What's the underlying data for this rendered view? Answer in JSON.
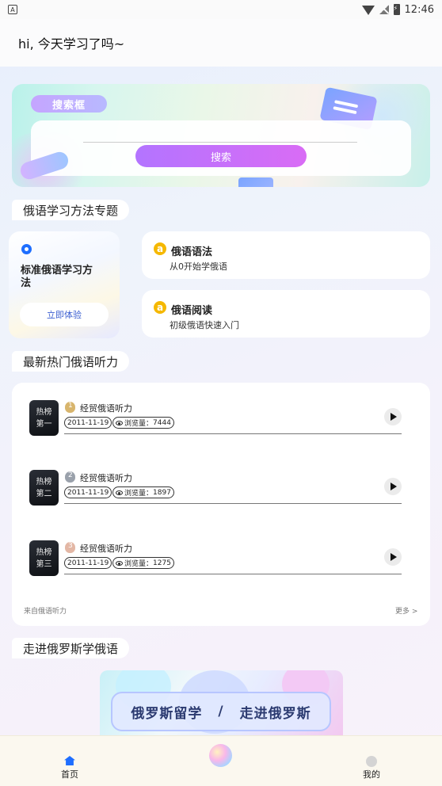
{
  "status_bar": {
    "app_icon_letter": "A",
    "time": "12:46"
  },
  "header": {
    "greeting": "hi, 今天学习了吗~"
  },
  "search": {
    "tag_label": "搜索框",
    "input_value": "",
    "input_placeholder": "",
    "button_label": "搜索"
  },
  "methods": {
    "section_title": "俄语学习方法专题",
    "feature": {
      "title": "标准俄语学习方法",
      "button_label": "立即体验"
    },
    "items": [
      {
        "title": "俄语语法",
        "subtitle": "从0开始学俄语"
      },
      {
        "title": "俄语阅读",
        "subtitle": "初级俄语快速入门"
      }
    ]
  },
  "hot": {
    "section_title": "最新热门俄语听力",
    "rows": [
      {
        "thumb_line1": "热榜",
        "thumb_line2": "第一",
        "rank": "1",
        "title": "经贸俄语听力",
        "date": "2011-11-19",
        "views_label": "浏览量：",
        "views": "7444"
      },
      {
        "thumb_line1": "热榜",
        "thumb_line2": "第二",
        "rank": "2",
        "title": "经贸俄语听力",
        "date": "2011-11-19",
        "views_label": "浏览量：",
        "views": "1897"
      },
      {
        "thumb_line1": "热榜",
        "thumb_line2": "第三",
        "rank": "3",
        "title": "经贸俄语听力",
        "date": "2011-11-19",
        "views_label": "浏览量：",
        "views": "1275"
      }
    ],
    "source": "来自俄语听力",
    "more": "更多 >"
  },
  "russia": {
    "section_title": "走进俄罗斯学俄语",
    "banner_left": "俄罗斯留学",
    "banner_sep": "/",
    "banner_right": "走进俄罗斯"
  },
  "bottom_nav": {
    "home_label": "首页",
    "mine_label": "我的"
  },
  "colors": {
    "accent_blue": "#1e6eff",
    "search_button": "#c270fa",
    "icon_yellow": "#f5b800"
  }
}
